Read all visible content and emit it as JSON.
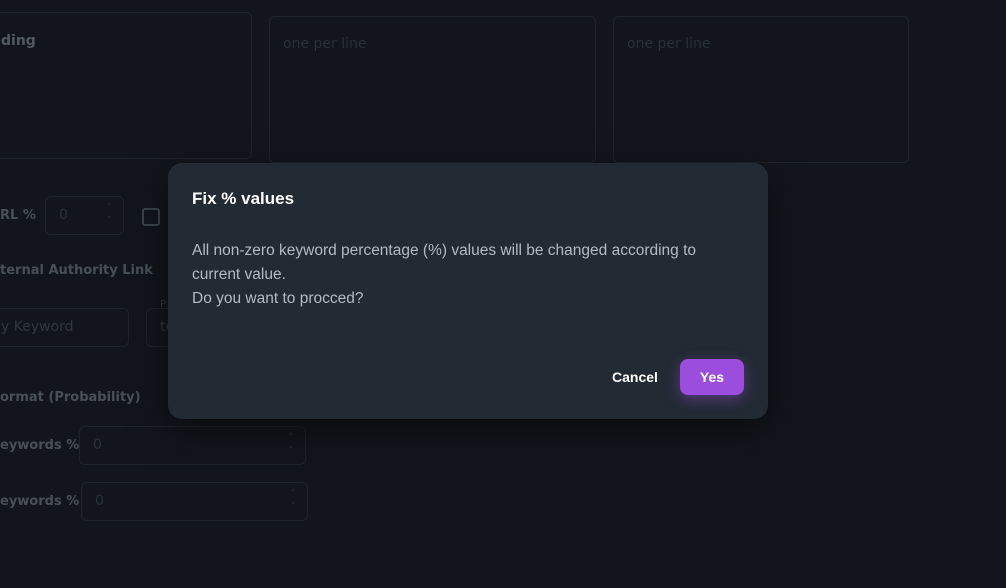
{
  "background": {
    "heading_fragment": "ding",
    "textarea_placeholder_1": "one per line",
    "textarea_placeholder_2": "one per line",
    "url_pct_label": "RL %",
    "url_pct_value": "0",
    "authority_link_label": "ternal Authority Link",
    "keyword_placeholder": "y Keyword",
    "second_field_text": "te",
    "second_field_label": "P",
    "format_label": "ormat (Probability)",
    "keywords_pct_label_1": "eywords %",
    "keywords_pct_value_1": "0",
    "keywords_pct_label_2": "eywords %",
    "keywords_pct_value_2": "0",
    "spin_up": "˄",
    "spin_down": "˅"
  },
  "dialog": {
    "title": "Fix % values",
    "message_line_1": "All non-zero keyword percentage (%) values will be changed according to current value.",
    "message_line_2": "Do you want to procced?",
    "cancel_label": "Cancel",
    "confirm_label": "Yes",
    "accent_color": "#9b4ddb"
  }
}
